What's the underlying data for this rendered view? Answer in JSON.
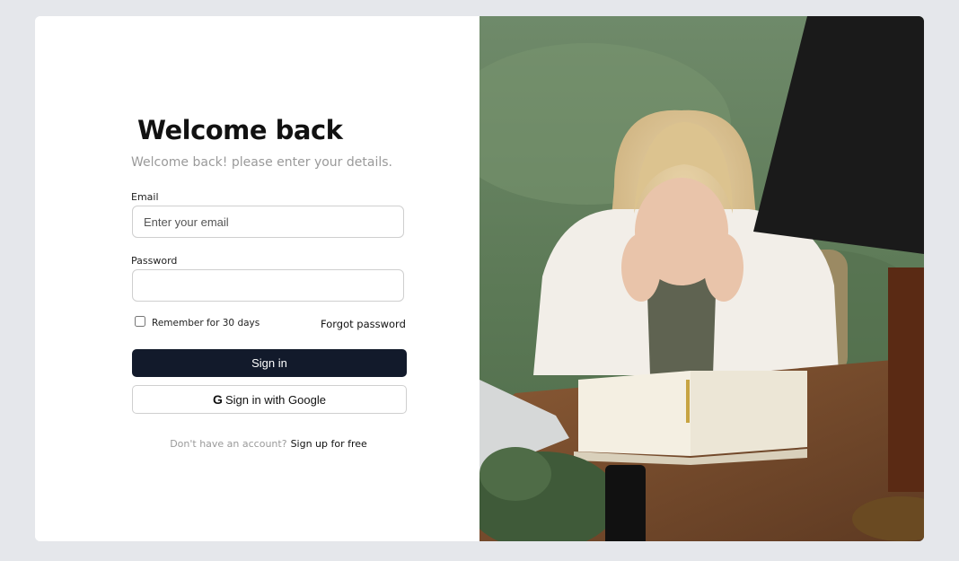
{
  "login": {
    "title": "Welcome back",
    "subtitle": "Welcome back! please enter your details.",
    "email_label": "Email",
    "email_placeholder": "Enter your email",
    "email_value": "",
    "password_label": "Password",
    "password_value": "",
    "remember_label": "Remember for 30 days",
    "remember_checked": false,
    "forgot_label": "Forgot password",
    "signin_label": "Sign in",
    "google_label": "Sign in with Google",
    "google_icon": "G",
    "signup_prompt": "Don't have an account?",
    "signup_link": "Sign up for free"
  },
  "colors": {
    "page_background": "#e5e7eb",
    "primary_button": "#121a2b",
    "muted_text": "#9a9a9a"
  }
}
